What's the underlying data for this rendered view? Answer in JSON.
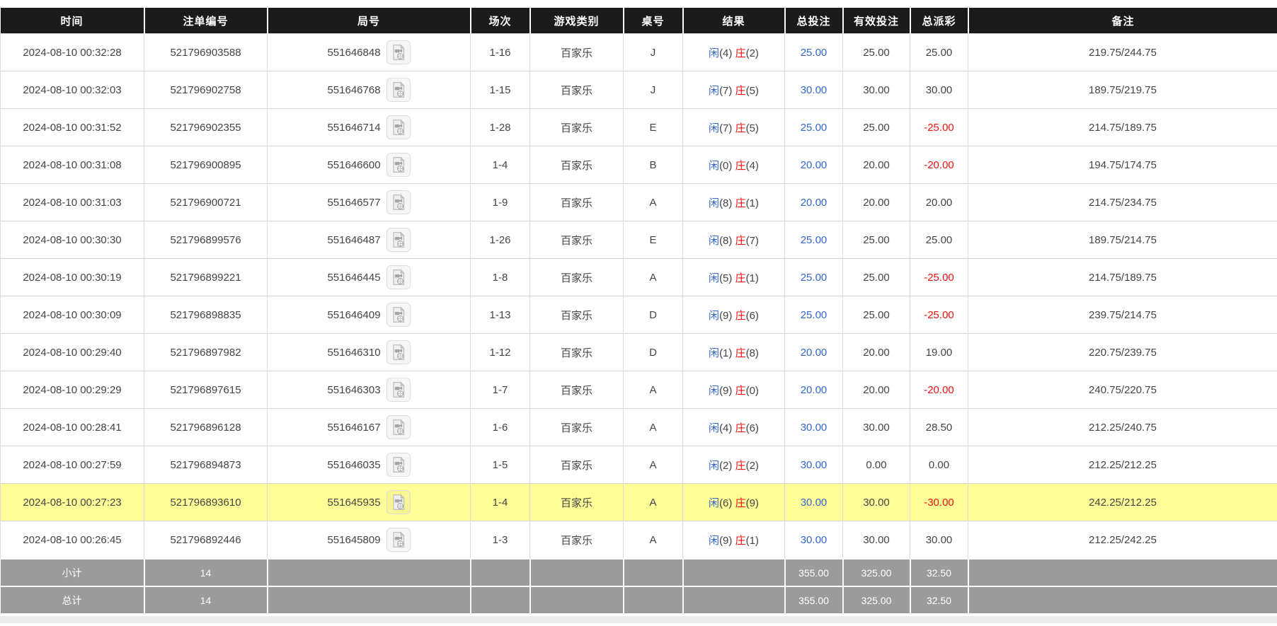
{
  "colors": {
    "header_bg": "#1b1b1b",
    "footer_bg": "#9b9b9b",
    "highlight_row": "#ffff99",
    "link_blue": "#3366cc",
    "negative_red": "#ee1111",
    "grid_line": "#d4d4d4"
  },
  "icons": {
    "replay": "video-file-icon"
  },
  "table": {
    "headers": [
      "时间",
      "注单编号",
      "局号",
      "场次",
      "游戏类别",
      "桌号",
      "结果",
      "总投注",
      "有效投注",
      "总派彩",
      "备注"
    ],
    "rows": [
      {
        "time": "2024-08-10 00:32:28",
        "bet_id": "521796903588",
        "round_id": "551646848",
        "session": "1-16",
        "game": "百家乐",
        "table_no": "J",
        "result": {
          "player": "闲",
          "player_score": "(4)",
          "banker": "庄",
          "banker_score": "(2)"
        },
        "total_bet": "25.00",
        "valid_bet": "25.00",
        "payout": "25.00",
        "remark": "219.75/244.75",
        "highlighted": false
      },
      {
        "time": "2024-08-10 00:32:03",
        "bet_id": "521796902758",
        "round_id": "551646768",
        "session": "1-15",
        "game": "百家乐",
        "table_no": "J",
        "result": {
          "player": "闲",
          "player_score": "(7)",
          "banker": "庄",
          "banker_score": "(5)"
        },
        "total_bet": "30.00",
        "valid_bet": "30.00",
        "payout": "30.00",
        "remark": "189.75/219.75",
        "highlighted": false
      },
      {
        "time": "2024-08-10 00:31:52",
        "bet_id": "521796902355",
        "round_id": "551646714",
        "session": "1-28",
        "game": "百家乐",
        "table_no": "E",
        "result": {
          "player": "闲",
          "player_score": "(7)",
          "banker": "庄",
          "banker_score": "(5)"
        },
        "total_bet": "25.00",
        "valid_bet": "25.00",
        "payout": "-25.00",
        "remark": "214.75/189.75",
        "highlighted": false
      },
      {
        "time": "2024-08-10 00:31:08",
        "bet_id": "521796900895",
        "round_id": "551646600",
        "session": "1-4",
        "game": "百家乐",
        "table_no": "B",
        "result": {
          "player": "闲",
          "player_score": "(0)",
          "banker": "庄",
          "banker_score": "(4)"
        },
        "total_bet": "20.00",
        "valid_bet": "20.00",
        "payout": "-20.00",
        "remark": "194.75/174.75",
        "highlighted": false
      },
      {
        "time": "2024-08-10 00:31:03",
        "bet_id": "521796900721",
        "round_id": "551646577",
        "session": "1-9",
        "game": "百家乐",
        "table_no": "A",
        "result": {
          "player": "闲",
          "player_score": "(8)",
          "banker": "庄",
          "banker_score": "(1)"
        },
        "total_bet": "20.00",
        "valid_bet": "20.00",
        "payout": "20.00",
        "remark": "214.75/234.75",
        "highlighted": false
      },
      {
        "time": "2024-08-10 00:30:30",
        "bet_id": "521796899576",
        "round_id": "551646487",
        "session": "1-26",
        "game": "百家乐",
        "table_no": "E",
        "result": {
          "player": "闲",
          "player_score": "(8)",
          "banker": "庄",
          "banker_score": "(7)"
        },
        "total_bet": "25.00",
        "valid_bet": "25.00",
        "payout": "25.00",
        "remark": "189.75/214.75",
        "highlighted": false
      },
      {
        "time": "2024-08-10 00:30:19",
        "bet_id": "521796899221",
        "round_id": "551646445",
        "session": "1-8",
        "game": "百家乐",
        "table_no": "A",
        "result": {
          "player": "闲",
          "player_score": "(5)",
          "banker": "庄",
          "banker_score": "(1)"
        },
        "total_bet": "25.00",
        "valid_bet": "25.00",
        "payout": "-25.00",
        "remark": "214.75/189.75",
        "highlighted": false
      },
      {
        "time": "2024-08-10 00:30:09",
        "bet_id": "521796898835",
        "round_id": "551646409",
        "session": "1-13",
        "game": "百家乐",
        "table_no": "D",
        "result": {
          "player": "闲",
          "player_score": "(9)",
          "banker": "庄",
          "banker_score": "(6)"
        },
        "total_bet": "25.00",
        "valid_bet": "25.00",
        "payout": "-25.00",
        "remark": "239.75/214.75",
        "highlighted": false
      },
      {
        "time": "2024-08-10 00:29:40",
        "bet_id": "521796897982",
        "round_id": "551646310",
        "session": "1-12",
        "game": "百家乐",
        "table_no": "D",
        "result": {
          "player": "闲",
          "player_score": "(1)",
          "banker": "庄",
          "banker_score": "(8)"
        },
        "total_bet": "20.00",
        "valid_bet": "20.00",
        "payout": "19.00",
        "remark": "220.75/239.75",
        "highlighted": false
      },
      {
        "time": "2024-08-10 00:29:29",
        "bet_id": "521796897615",
        "round_id": "551646303",
        "session": "1-7",
        "game": "百家乐",
        "table_no": "A",
        "result": {
          "player": "闲",
          "player_score": "(9)",
          "banker": "庄",
          "banker_score": "(0)"
        },
        "total_bet": "20.00",
        "valid_bet": "20.00",
        "payout": "-20.00",
        "remark": "240.75/220.75",
        "highlighted": false
      },
      {
        "time": "2024-08-10 00:28:41",
        "bet_id": "521796896128",
        "round_id": "551646167",
        "session": "1-6",
        "game": "百家乐",
        "table_no": "A",
        "result": {
          "player": "闲",
          "player_score": "(4)",
          "banker": "庄",
          "banker_score": "(6)"
        },
        "total_bet": "30.00",
        "valid_bet": "30.00",
        "payout": "28.50",
        "remark": "212.25/240.75",
        "highlighted": false
      },
      {
        "time": "2024-08-10 00:27:59",
        "bet_id": "521796894873",
        "round_id": "551646035",
        "session": "1-5",
        "game": "百家乐",
        "table_no": "A",
        "result": {
          "player": "闲",
          "player_score": "(2)",
          "banker": "庄",
          "banker_score": "(2)"
        },
        "total_bet": "30.00",
        "valid_bet": "0.00",
        "payout": "0.00",
        "remark": "212.25/212.25",
        "highlighted": false
      },
      {
        "time": "2024-08-10 00:27:23",
        "bet_id": "521796893610",
        "round_id": "551645935",
        "session": "1-4",
        "game": "百家乐",
        "table_no": "A",
        "result": {
          "player": "闲",
          "player_score": "(6)",
          "banker": "庄",
          "banker_score": "(9)"
        },
        "total_bet": "30.00",
        "valid_bet": "30.00",
        "payout": "-30.00",
        "remark": "242.25/212.25",
        "highlighted": true
      },
      {
        "time": "2024-08-10 00:26:45",
        "bet_id": "521796892446",
        "round_id": "551645809",
        "session": "1-3",
        "game": "百家乐",
        "table_no": "A",
        "result": {
          "player": "闲",
          "player_score": "(9)",
          "banker": "庄",
          "banker_score": "(1)"
        },
        "total_bet": "30.00",
        "valid_bet": "30.00",
        "payout": "30.00",
        "remark": "212.25/242.25",
        "highlighted": false
      }
    ],
    "footer": [
      {
        "label": "小计",
        "count": "14",
        "total_bet": "355.00",
        "valid_bet": "325.00",
        "payout": "32.50"
      },
      {
        "label": "总计",
        "count": "14",
        "total_bet": "355.00",
        "valid_bet": "325.00",
        "payout": "32.50"
      }
    ]
  }
}
